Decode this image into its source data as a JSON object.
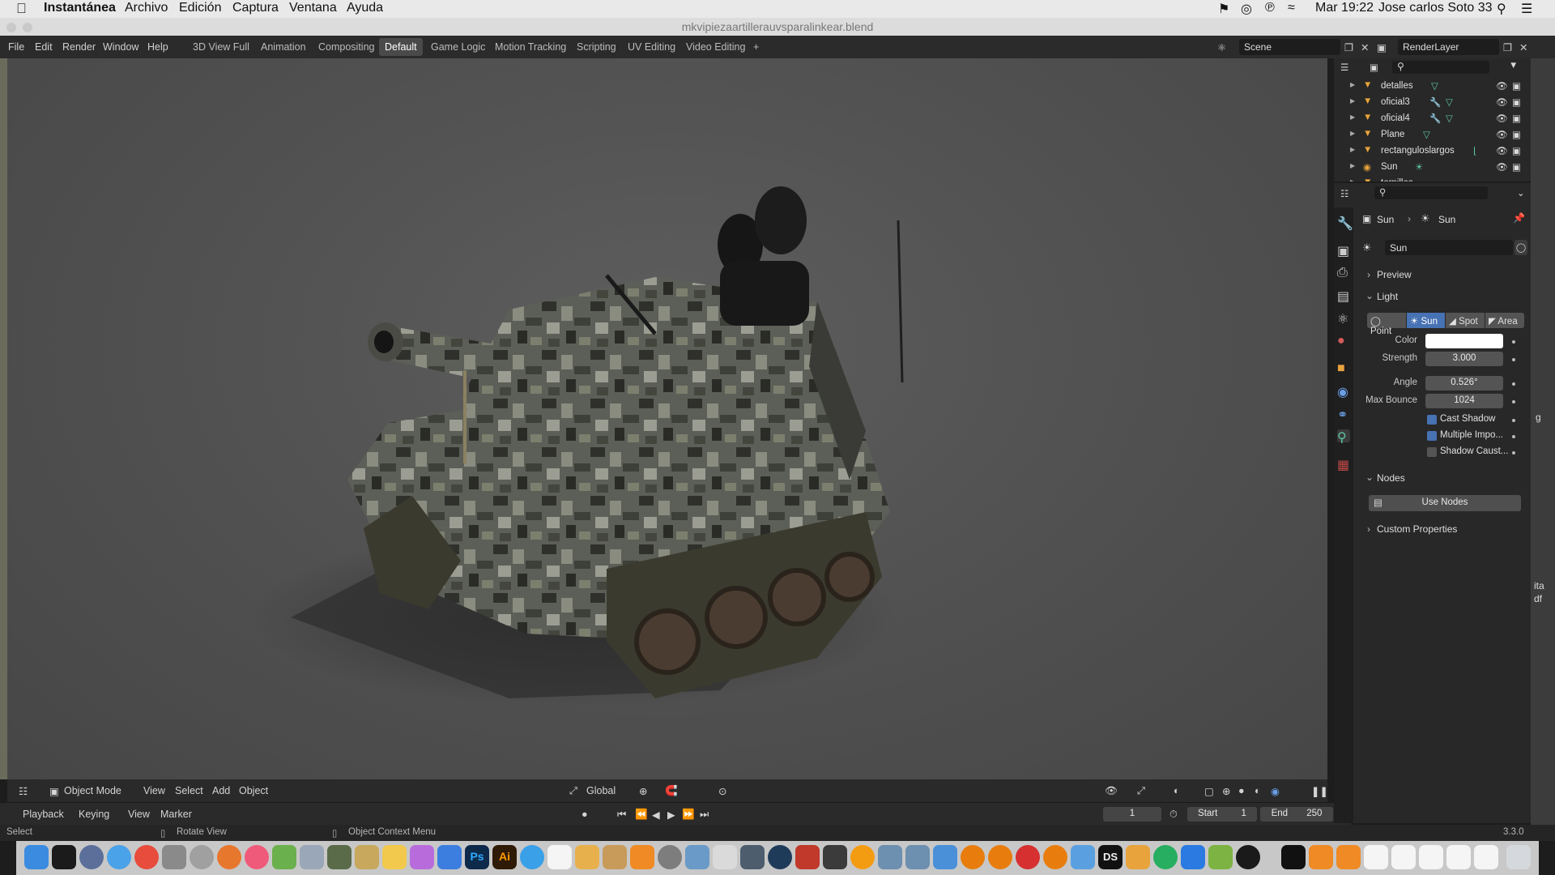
{
  "mac_menu": {
    "apple": "",
    "app_name": "Instantánea",
    "items": [
      "Archivo",
      "Edición",
      "Captura",
      "Ventana",
      "Ayuda"
    ],
    "clock": "Mar 19:22",
    "user": "Jose carlos Soto 33"
  },
  "window": {
    "title": "mkvipiezaartillerauvsparalinkear.blend"
  },
  "topbar": {
    "menus": [
      "File",
      "Edit",
      "Render",
      "Window",
      "Help"
    ],
    "workspaces": [
      "3D View Full",
      "Animation",
      "Compositing",
      "Default",
      "Game Logic",
      "Motion Tracking",
      "Scripting",
      "UV Editing",
      "Video Editing"
    ],
    "active_workspace": "Default",
    "add_tab": "+",
    "scene": "Scene",
    "render_layer": "RenderLayer"
  },
  "outliner": {
    "rows": [
      {
        "name": "detalles",
        "type": "mesh"
      },
      {
        "name": "oficial3",
        "type": "mesh"
      },
      {
        "name": "oficial4",
        "type": "mesh"
      },
      {
        "name": "Plane",
        "type": "mesh"
      },
      {
        "name": "rectanguloslargos",
        "type": "curve"
      },
      {
        "name": "Sun",
        "type": "light"
      },
      {
        "name": "tornillos",
        "type": "mesh"
      }
    ]
  },
  "properties": {
    "breadcrumb_a": "Sun",
    "breadcrumb_b": "Sun",
    "datablock": "Sun",
    "panel_preview": "Preview",
    "panel_light": "Light",
    "light_types": [
      "Point",
      "Sun",
      "Spot",
      "Area"
    ],
    "active_light_type": "Sun",
    "color_label": "Color",
    "color_value": "#ffffff",
    "strength_label": "Strength",
    "strength": "3.000",
    "angle_label": "Angle",
    "angle": "0.526°",
    "max_bounce_label": "Max Bounce",
    "max_bounce": "1024",
    "cast_shadow": "Cast Shadow",
    "multiple_importance": "Multiple Impo...",
    "shadow_caustics": "Shadow Caust...",
    "panel_nodes": "Nodes",
    "use_nodes": "Use Nodes",
    "panel_custom": "Custom Properties"
  },
  "viewport_header": {
    "mode": "Object Mode",
    "menus": [
      "View",
      "Select",
      "Add",
      "Object"
    ],
    "orientation": "Global"
  },
  "timeline": {
    "menus": [
      "Playback",
      "Keying",
      "View",
      "Marker"
    ],
    "current_frame": "1",
    "start_label": "Start",
    "start": "1",
    "end_label": "End",
    "end": "250"
  },
  "statusbar": {
    "left": "Select",
    "middle": "Rotate View",
    "right": "Object Context Menu",
    "version": "3.3.0"
  },
  "edge_text": {
    "g": "g",
    "ita": "ita",
    "df": "df"
  },
  "dock": {
    "icons": [
      "finder-icon",
      "terminal-icon",
      "launchpad-icon",
      "safari-icon",
      "chrome-icon",
      "photo-app-icon",
      "rocket-icon",
      "firefox-icon",
      "itunes-icon",
      "utorrent-icon",
      "scanner-icon",
      "game-icon",
      "folder-icon",
      "notes-icon",
      "affinity-icon",
      "gear-icon",
      "photoshop-icon",
      "illustrator-icon",
      "appstore-icon",
      "textedit-icon",
      "preview-icon",
      "box-icon",
      "vlc-icon",
      "preferences-icon",
      "person-icon",
      "scissors-icon",
      "stats-icon",
      "globe-icon",
      "pencil-icon",
      "camera-icon",
      "books-icon",
      "tool-icon",
      "tool2-icon",
      "fingerprint-icon",
      "blender-icon",
      "blender2-icon",
      "s-icon",
      "blender3-icon",
      "app-icon",
      "ds-icon",
      "folder2-icon",
      "colors-icon",
      "bluetooth-icon",
      "android-icon",
      "nvidia-icon",
      "terminal2-icon",
      "doc-icon",
      "doc2-icon",
      "doc3-icon",
      "doc4-icon",
      "doc5-icon",
      "doc6-icon",
      "doc7-icon",
      "trash-icon"
    ],
    "ps_label": "Ps",
    "ai_label": "Ai",
    "ds_label": "DS"
  }
}
